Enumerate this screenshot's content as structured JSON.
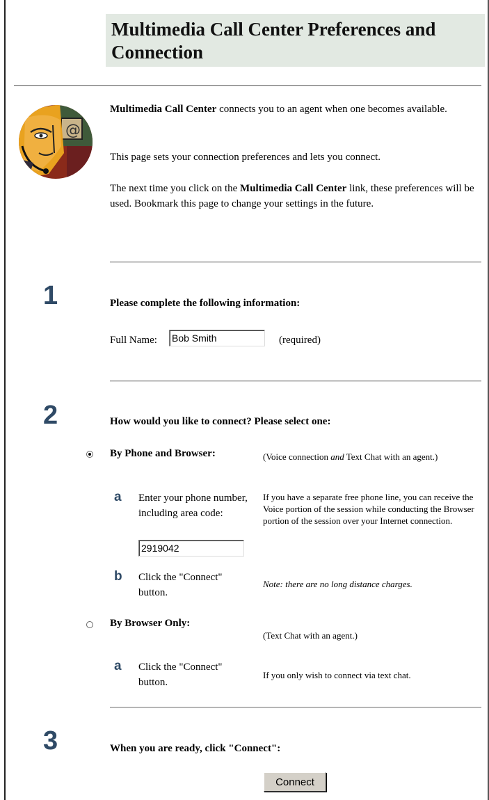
{
  "header": {
    "title": "Multimedia Call Center Preferences and Connection"
  },
  "intro": {
    "brand": "Multimedia Call Center",
    "line1_rest": " connects you to an agent when one becomes available.",
    "line2": "This page sets your connection preferences and lets you connect.",
    "line3_start": "The next time you click on the ",
    "line3_brand": "Multimedia Call Center",
    "line3_rest": " link, these preferences will be used. Bookmark this page to change your settings in the future."
  },
  "step1": {
    "number": "1",
    "heading": "Please complete the following information:",
    "full_name_label": "Full Name:",
    "full_name_value": "Bob Smith",
    "required_note": "(required)"
  },
  "step2": {
    "number": "2",
    "heading": "How would you like to connect? Please select one:",
    "option_phone": {
      "label": "By Phone and Browser:",
      "selected": true,
      "desc_part1": "(Voice connection ",
      "desc_italic": "and",
      "desc_part2": " Text Chat with an agent.)",
      "sub_a": {
        "letter": "a",
        "text_line1": "Enter your phone number,",
        "text_line2": "including area code:",
        "phone_value": "2919042",
        "desc": "If you have a separate free phone line, you can receive the Voice portion of the session while conducting the Browser portion of the session over your Internet connection."
      },
      "sub_b": {
        "letter": "b",
        "text": "Click the \"Connect\" button.",
        "note": "Note: there are no long distance charges."
      }
    },
    "option_browser": {
      "label": "By Browser Only:",
      "selected": false,
      "desc": "(Text Chat with an agent.)",
      "sub_a": {
        "letter": "a",
        "text": "Click the \"Connect\" button.",
        "desc": "If you only wish to connect via text chat."
      }
    }
  },
  "step3": {
    "number": "3",
    "heading": "When you are ready, click \"Connect\":",
    "connect_button": "Connect"
  },
  "colors": {
    "header_bg": "#e2e9e2",
    "step_number": "#2f4a66"
  }
}
